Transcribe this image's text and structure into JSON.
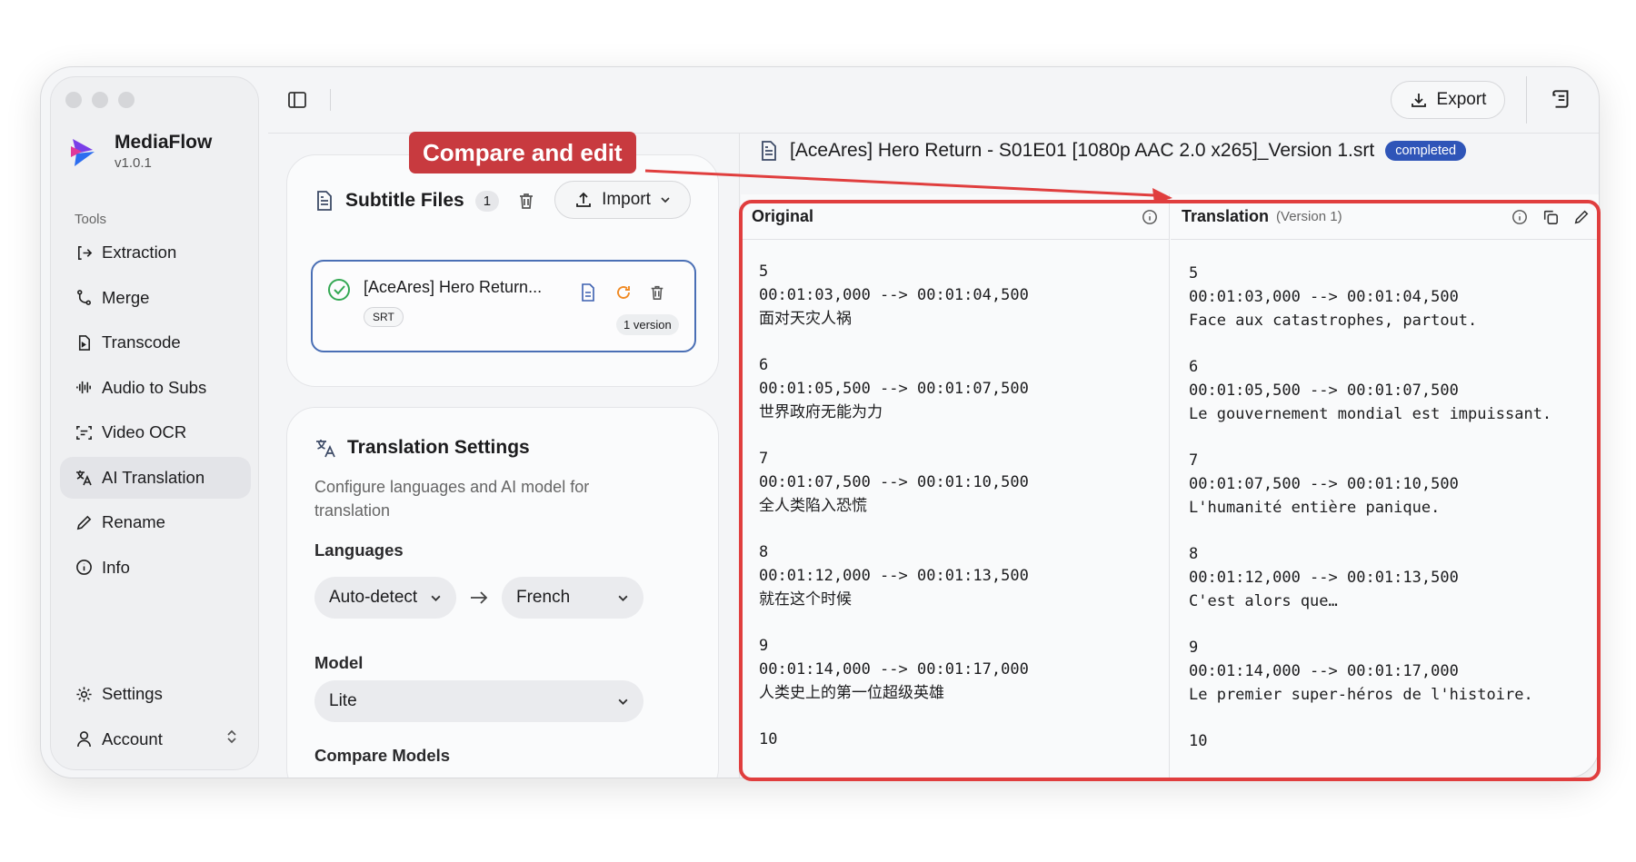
{
  "app": {
    "name": "MediaFlow",
    "version": "v1.0.1"
  },
  "sidebar": {
    "tools_label": "Tools",
    "items": [
      {
        "label": "Extraction",
        "icon": "extraction-icon"
      },
      {
        "label": "Merge",
        "icon": "merge-icon"
      },
      {
        "label": "Transcode",
        "icon": "transcode-icon"
      },
      {
        "label": "Audio to Subs",
        "icon": "audio-wave-icon"
      },
      {
        "label": "Video OCR",
        "icon": "ocr-icon"
      },
      {
        "label": "AI Translation",
        "icon": "translate-icon",
        "active": true
      },
      {
        "label": "Rename",
        "icon": "pen-icon"
      },
      {
        "label": "Info",
        "icon": "info-icon"
      }
    ],
    "bottom": [
      {
        "label": "Settings",
        "icon": "gear-icon"
      },
      {
        "label": "Account",
        "icon": "user-icon"
      }
    ]
  },
  "topbar": {
    "export_label": "Export"
  },
  "files": {
    "title": "Subtitle Files",
    "count": "1",
    "import_label": "Import",
    "item": {
      "name": "[AceAres] Hero Return...",
      "tag": "SRT",
      "versions": "1 version"
    }
  },
  "settings": {
    "title": "Translation Settings",
    "description": "Configure languages and AI model for translation",
    "languages_label": "Languages",
    "source_lang": "Auto-detect",
    "target_lang": "French",
    "model_label": "Model",
    "model": "Lite",
    "compare_label": "Compare Models"
  },
  "panel": {
    "filename": "[AceAres] Hero Return - S01E01 [1080p AAC 2.0 x265]_Version 1.srt",
    "status": "completed",
    "original_label": "Original",
    "translation_label": "Translation",
    "translation_version": "(Version 1)"
  },
  "original_entries": [
    {
      "index": "5",
      "time": "00:01:03,000 --> 00:01:04,500",
      "text": "面对天灾人祸"
    },
    {
      "index": "6",
      "time": "00:01:05,500 --> 00:01:07,500",
      "text": "世界政府无能为力"
    },
    {
      "index": "7",
      "time": "00:01:07,500 --> 00:01:10,500",
      "text": "全人类陷入恐慌"
    },
    {
      "index": "8",
      "time": "00:01:12,000 --> 00:01:13,500",
      "text": "就在这个时候"
    },
    {
      "index": "9",
      "time": "00:01:14,000 --> 00:01:17,000",
      "text": "人类史上的第一位超级英雄"
    },
    {
      "index": "10",
      "time": "",
      "text": ""
    }
  ],
  "translation_entries": [
    {
      "index": "5",
      "time": "00:01:03,000 --> 00:01:04,500",
      "text": "Face aux catastrophes, partout."
    },
    {
      "index": "6",
      "time": "00:01:05,500 --> 00:01:07,500",
      "text": "Le gouvernement mondial est impuissant."
    },
    {
      "index": "7",
      "time": "00:01:07,500 --> 00:01:10,500",
      "text": "L'humanité entière panique."
    },
    {
      "index": "8",
      "time": "00:01:12,000 --> 00:01:13,500",
      "text": "C'est alors que…"
    },
    {
      "index": "9",
      "time": "00:01:14,000 --> 00:01:17,000",
      "text": "Le premier super-héros de l'histoire."
    },
    {
      "index": "10",
      "time": "",
      "text": ""
    }
  ],
  "annotation": {
    "label": "Compare and edit"
  },
  "colors": {
    "accent": "#2f55b8",
    "annotation": "#e03e3e",
    "success": "#34a853",
    "warning": "#f08a24"
  }
}
